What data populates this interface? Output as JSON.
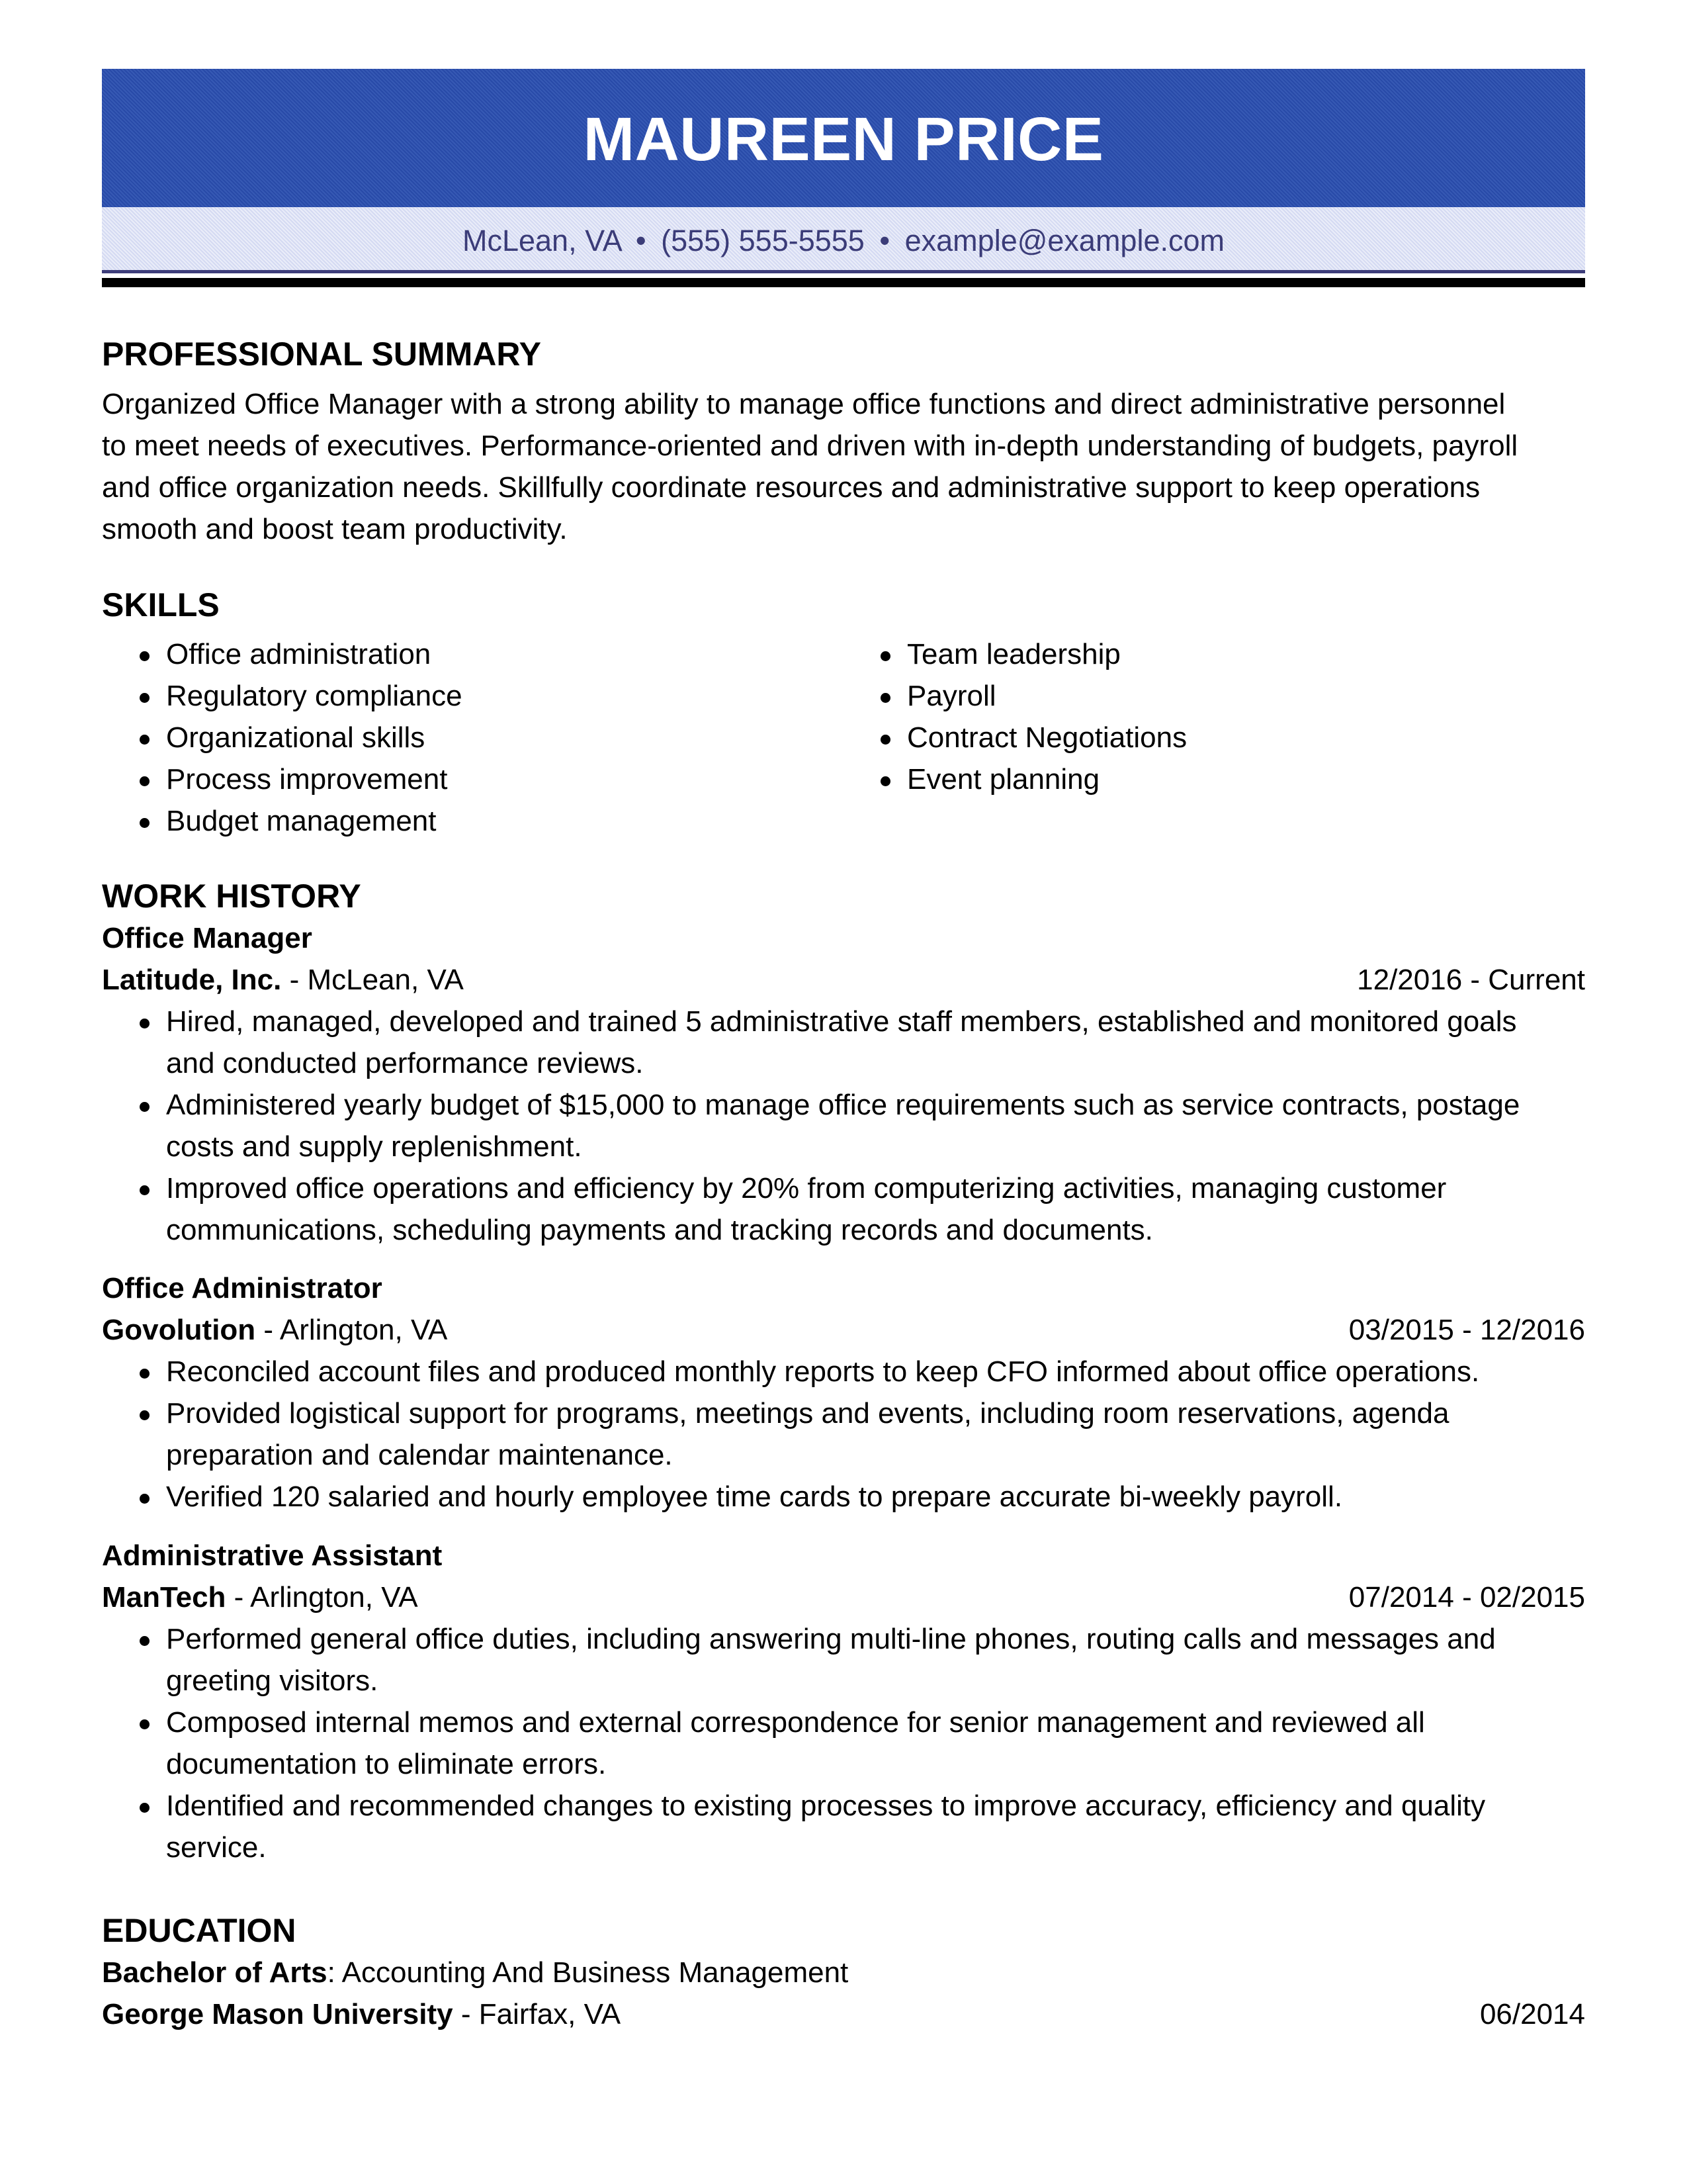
{
  "header": {
    "name": "MAUREEN PRICE",
    "contact": {
      "location": "McLean, VA",
      "phone": "(555) 555-5555",
      "email": "example@example.com",
      "separator": "•"
    },
    "colors": {
      "name_band": "#2a4faf",
      "contact_band": "#dfe3f6",
      "contact_text": "#3b3c78",
      "rule_thin": "#3d3d7a",
      "rule_thick": "#000000"
    }
  },
  "summary": {
    "title": "PROFESSIONAL SUMMARY",
    "lines": [
      "Organized Office Manager with a strong ability to manage office functions and direct administrative personnel",
      "to meet needs of executives. Performance-oriented and driven with in-depth understanding of budgets, payroll",
      "and office organization needs. Skillfully coordinate resources and administrative support to keep operations",
      "smooth and boost team productivity."
    ]
  },
  "skills": {
    "title": "SKILLS",
    "left": [
      "Office administration",
      "Regulatory compliance",
      "Organizational skills",
      "Process improvement",
      "Budget management"
    ],
    "right": [
      "Team leadership",
      "Payroll",
      "Contract Negotiations",
      "Event planning"
    ]
  },
  "work": {
    "title": "WORK HISTORY",
    "jobs": [
      {
        "title": "Office Manager",
        "company": "Latitude, Inc.",
        "location": " - McLean, VA",
        "dates": "12/2016 - Current",
        "bullets": [
          [
            "Hired, managed, developed and trained 5 administrative staff members, established and monitored goals",
            "and conducted performance reviews."
          ],
          [
            "Administered yearly budget of $15,000 to manage office requirements such as service contracts, postage",
            "costs and supply replenishment."
          ],
          [
            "Improved office operations and efficiency by 20% from computerizing activities, managing customer",
            "communications, scheduling payments and tracking records and documents."
          ]
        ]
      },
      {
        "title": "Office Administrator",
        "company": "Govolution",
        "location": " - Arlington, VA",
        "dates": "03/2015 - 12/2016",
        "bullets": [
          [
            "Reconciled account files and produced monthly reports to keep CFO informed about office operations."
          ],
          [
            "Provided logistical support for programs, meetings and events, including room reservations, agenda",
            "preparation and calendar maintenance."
          ],
          [
            "Verified 120 salaried and hourly employee time cards to prepare accurate bi-weekly payroll."
          ]
        ]
      },
      {
        "title": "Administrative Assistant",
        "company": "ManTech",
        "location": " - Arlington, VA",
        "dates": "07/2014 - 02/2015",
        "bullets": [
          [
            "Performed general office duties, including answering multi-line phones, routing calls and messages and",
            "greeting visitors."
          ],
          [
            "Composed internal memos and external correspondence for senior management and reviewed all",
            "documentation to eliminate errors."
          ],
          [
            "Identified and recommended changes to existing processes to improve accuracy, efficiency and quality",
            "service."
          ]
        ]
      }
    ]
  },
  "education": {
    "title": "EDUCATION",
    "degree": "Bachelor of Arts",
    "field": ": Accounting And Business Management",
    "school": "George Mason University",
    "location": " - Fairfax, VA",
    "date": "06/2014"
  }
}
